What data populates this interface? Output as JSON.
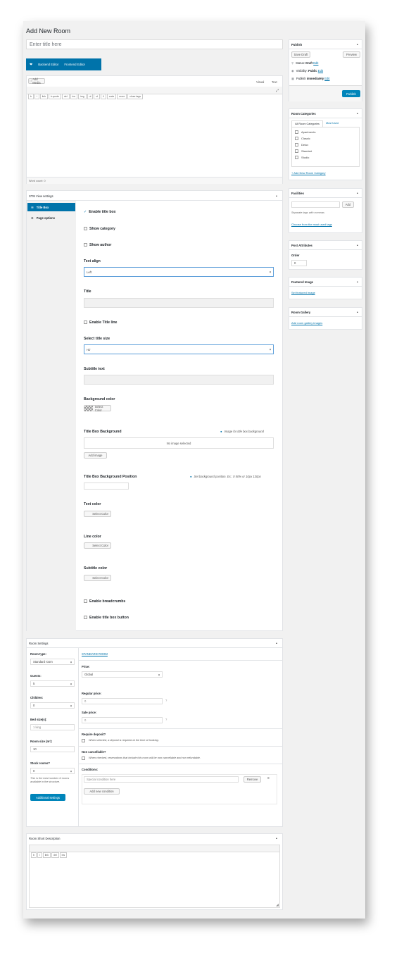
{
  "page_title": "Add New Room",
  "title_placeholder": "Enter title here",
  "editor": {
    "backend_label": "Backend Editor",
    "frontend_label": "Frontend Editor",
    "add_media_label": "Add Media",
    "tab_visual": "Visual",
    "tab_text": "Text",
    "quicktags": [
      "b",
      "i",
      "link",
      "b-quote",
      "del",
      "ins",
      "img",
      "ul",
      "ol",
      "li",
      "code",
      "more",
      "close tags"
    ],
    "word_count": "Word count: 0"
  },
  "publish": {
    "title": "Publish",
    "save_draft": "Save Draft",
    "preview": "Preview",
    "status_label": "Status:",
    "status_value": "Draft",
    "visibility_label": "Visibility:",
    "visibility_value": "Public",
    "publish_label": "Publish",
    "publish_value": "immediately",
    "edit": "Edit",
    "publish_button": "Publish"
  },
  "room_categories": {
    "title": "Room Categories",
    "tab_all": "All Room Categories",
    "tab_most": "Most Used",
    "items": [
      "Apartments",
      "Classic",
      "Delux",
      "Standart",
      "Studio"
    ],
    "add_link": "+ Add New Room Category"
  },
  "facilities": {
    "title": "Facilities",
    "add_button": "Add",
    "hint": "Separate tags with commas",
    "choose_link": "Choose from the most used tags"
  },
  "post_attributes": {
    "title": "Post Attributes",
    "order_label": "Order",
    "order_value": "0"
  },
  "featured_image": {
    "title": "Featured Image",
    "link": "Set featured image"
  },
  "room_gallery": {
    "title": "Room Gallery",
    "link": "Add room gallery images"
  },
  "stm": {
    "title": "STM View settings",
    "tab_title_box": "Title Box",
    "tab_page_options": "Page options",
    "enable_title_box": "Enable title box",
    "show_category": "Show category",
    "show_author": "Show author",
    "text_align_label": "Text align",
    "text_align_value": "Left",
    "title_label": "Title",
    "enable_title_line": "Enable Title line",
    "select_title_size_label": "Select title size",
    "select_title_size_value": "H2",
    "subtitle_text_label": "Subtitle text",
    "bg_color_label": "Background color",
    "select_color": "Select Color",
    "title_box_bg_label": "Title Box Background",
    "title_box_bg_hint": "Image for title box background",
    "no_image": "No image selected",
    "add_image": "Add image",
    "bg_position_label": "Title Box Background Position",
    "bg_position_hint": "Set background position. Ex.: 0 50% or 10px 130px",
    "text_color_label": "Text color",
    "line_color_label": "Line color",
    "subtitle_color_label": "Subtitle color",
    "enable_breadcrumbs": "Enable breadcrumbs",
    "enable_title_box_button": "Enable title box button"
  },
  "room_settings": {
    "title": "Room Settings",
    "room_type_label": "Room type:",
    "room_type_value": "Standard room",
    "guests_label": "Guests:",
    "guests_value": "5",
    "children_label": "Children:",
    "children_value": "0",
    "bed_size_label": "Bed size(s):",
    "bed_size_placeholder": "1 king",
    "room_size_label": "Room size (m²):",
    "room_size_value": "10",
    "stock_label": "Stock rooms?",
    "stock_value": "0",
    "stock_hint": "This is the total number of rooms available in the structure.",
    "additional_settings": "Additional settings",
    "section_link": "STANDARD ROOM",
    "price_label": "Price:",
    "price_value": "Global",
    "regular_price_label": "Regular price:",
    "regular_price_value": "0",
    "sale_price_label": "Sale price:",
    "sale_price_value": "0",
    "require_deposit_label": "Require deposit?",
    "require_deposit_hint": "When selected, a deposit is required at the time of booking.",
    "non_cancellable_label": "Non cancellable?",
    "non_cancellable_hint": "When checked, reservations that include this room will be non cancellable and non refundable.",
    "conditions_label": "Conditions:",
    "condition_placeholder": "Special condition here",
    "remove": "Remove",
    "add_condition": "Add new condition"
  },
  "short_desc": {
    "title": "Room Short Description",
    "quicktags": [
      "b",
      "i",
      "link",
      "del",
      "ins"
    ]
  },
  "colors": {
    "accent": "#0085ba",
    "link": "#0073aa"
  }
}
